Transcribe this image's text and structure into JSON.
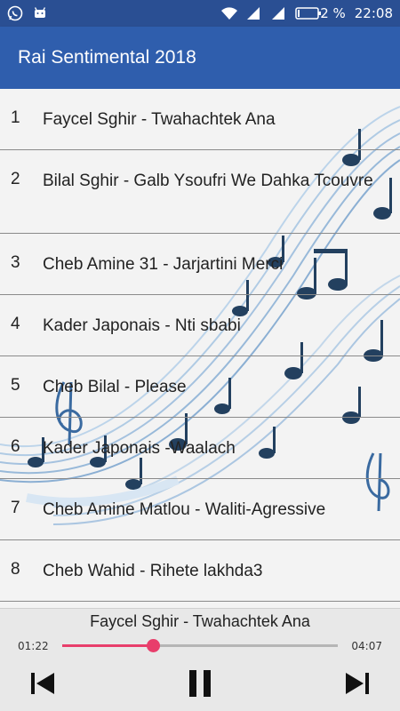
{
  "status_bar": {
    "battery": "2 %",
    "time": "22:08",
    "icons": [
      "whatsapp-icon",
      "android-icon",
      "wifi-icon",
      "signal-icon",
      "signal-icon",
      "battery-icon"
    ]
  },
  "app_bar": {
    "title": "Rai Sentimental 2018"
  },
  "tracks": [
    {
      "num": "1",
      "title": "Faycel Sghir - Twahachtek Ana"
    },
    {
      "num": "2",
      "title": "Bilal Sghir - Galb Ysoufri We Dahka Tcouvre"
    },
    {
      "num": "3",
      "title": "Cheb Amine 31 - Jarjartini Merci"
    },
    {
      "num": "4",
      "title": "Kader Japonais - Nti sbabi"
    },
    {
      "num": "5",
      "title": "Cheb Bilal - Please"
    },
    {
      "num": "6",
      "title": "Kader Japonais -Waalach"
    },
    {
      "num": "7",
      "title": "Cheb Amine Matlou - Waliti-Agressive"
    },
    {
      "num": "8",
      "title": "Cheb Wahid - Rihete lakhda3"
    }
  ],
  "player": {
    "now_playing": "Faycel Sghir - Twahachtek Ana",
    "current_time": "01:22",
    "total_time": "04:07",
    "progress": 0.33,
    "accent": "#e83e6b"
  },
  "colors": {
    "status_bar": "#2a4f93",
    "app_bar": "#2f5ead",
    "highlight": "#f3d53a"
  }
}
